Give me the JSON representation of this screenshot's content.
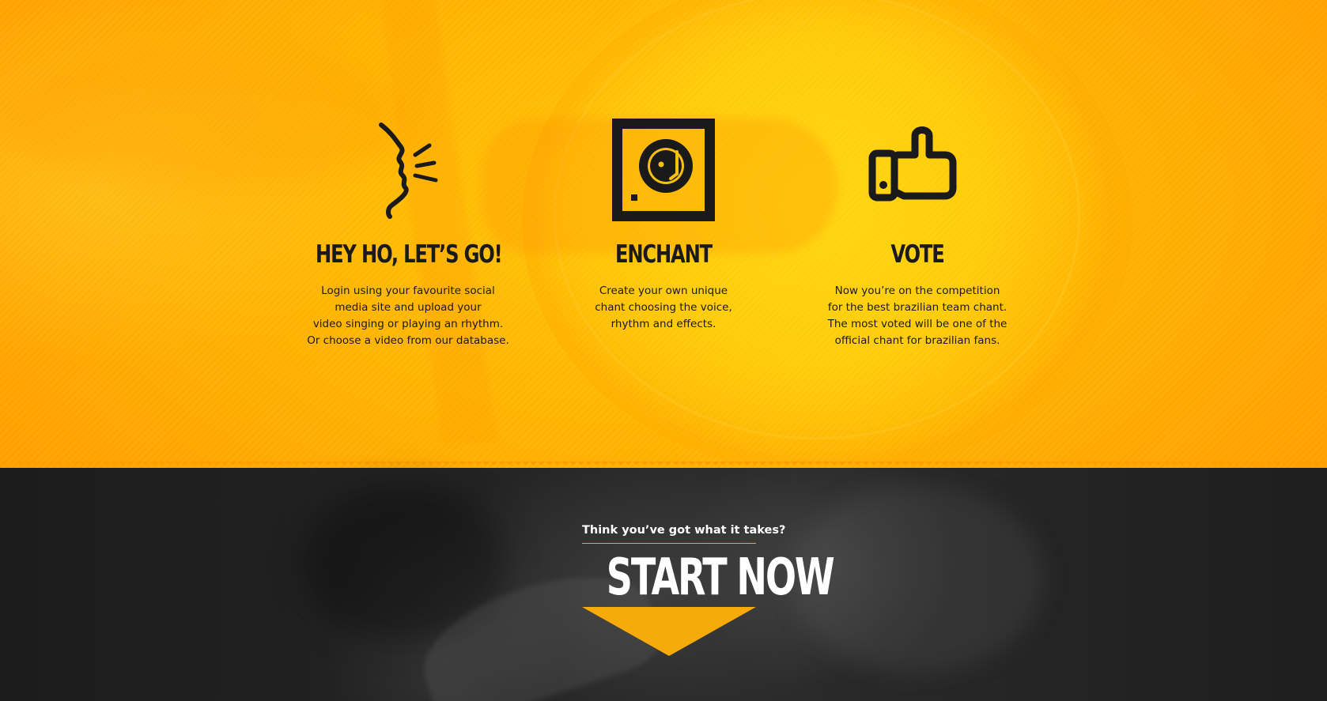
{
  "features": [
    {
      "icon": "shouting-mouth-icon",
      "title": "HEY HO, LET’S GO!",
      "lines": [
        "Login using your favourite social",
        "media site and upload your",
        "video singing or playing an rhythm.",
        "Or choose a video from our database."
      ]
    },
    {
      "icon": "turntable-icon",
      "title": "ENCHANT",
      "lines": [
        "Create your own unique",
        "chant choosing the voice,",
        "rhythm and effects."
      ]
    },
    {
      "icon": "thumbs-up-icon",
      "title": "VOTE",
      "lines": [
        "Now you’re on the competition",
        "for the best brazilian team chant.",
        "The most voted will be one of the",
        "official chant for brazilian fans."
      ]
    }
  ],
  "cta": {
    "question": "Think you’ve got what it takes?",
    "button_label": "START NOW"
  },
  "colors": {
    "accent": "#f7ab0a",
    "dark_text": "#1a1a1a",
    "dark_background": "#1c1c1c"
  }
}
